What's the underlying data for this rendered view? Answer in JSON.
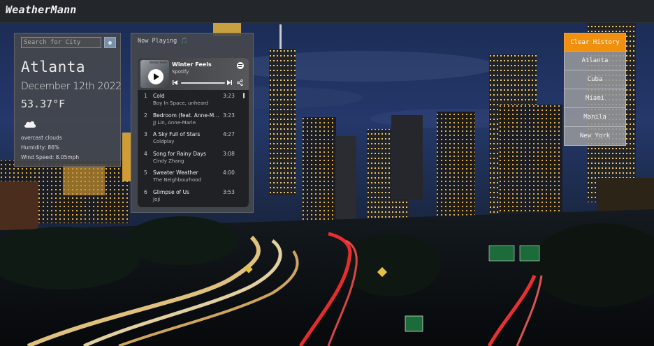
{
  "app": {
    "brand": "WeatherMann"
  },
  "search": {
    "placeholder": "Search for City",
    "value": ""
  },
  "weather": {
    "city": "Atlanta",
    "date": "December 12th 2022",
    "temperature": "53.37°F",
    "icon": "cloud-icon",
    "description": "overcast clouds",
    "humidity": "Humidity: 86%",
    "wind": "Wind Speed: 8.05mph"
  },
  "now_playing": {
    "title": "Now Playing 🎵",
    "track": "Winter Feels",
    "source": "Spotify",
    "art_text": "Winter Feels",
    "tracks": [
      {
        "num": "1",
        "title": "Cold",
        "artist": "Boy In Space, unheard",
        "duration": "3:23"
      },
      {
        "num": "2",
        "title": "Bedroom (feat. Anne-Mar...",
        "artist": "JJ Lin, Anne-Marie",
        "duration": "3:23"
      },
      {
        "num": "3",
        "title": "A Sky Full of Stars",
        "artist": "Coldplay",
        "duration": "4:27"
      },
      {
        "num": "4",
        "title": "Song for Rainy Days",
        "artist": "Cindy Zhang",
        "duration": "3:08"
      },
      {
        "num": "5",
        "title": "Sweater Weather",
        "artist": "The Neighbourhood",
        "duration": "4:00"
      },
      {
        "num": "6",
        "title": "Glimpse of Us",
        "artist": "Joji",
        "duration": "3:53"
      }
    ]
  },
  "history": {
    "clear_label": "Clear History",
    "cities": [
      "Atlanta",
      "Cuba",
      "Miami",
      "Manila",
      "New York"
    ]
  },
  "colors": {
    "accent": "#f0900e",
    "topbar": "#23272b",
    "panel": "#46484c"
  }
}
